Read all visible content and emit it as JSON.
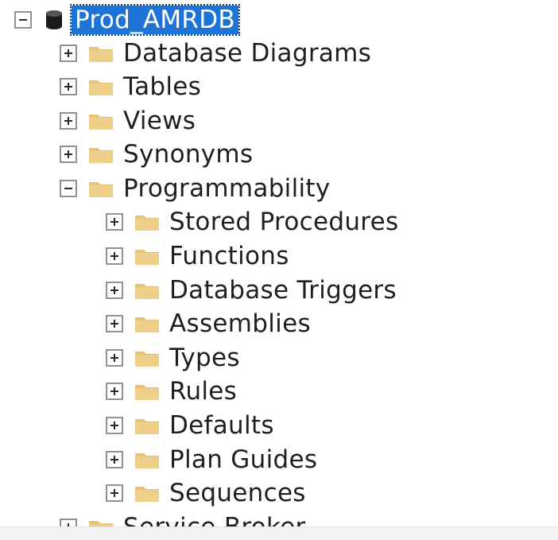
{
  "tree": {
    "root": {
      "label": "Prod_AMRDB",
      "expanded": true,
      "selected": true,
      "icon": "database-icon"
    },
    "children": [
      {
        "label": "Database Diagrams",
        "expanded": false,
        "icon": "folder-icon"
      },
      {
        "label": "Tables",
        "expanded": false,
        "icon": "folder-icon"
      },
      {
        "label": "Views",
        "expanded": false,
        "icon": "folder-icon"
      },
      {
        "label": "Synonyms",
        "expanded": false,
        "icon": "folder-icon"
      },
      {
        "label": "Programmability",
        "expanded": true,
        "icon": "folder-icon",
        "children": [
          {
            "label": "Stored Procedures",
            "expanded": false,
            "icon": "folder-icon"
          },
          {
            "label": "Functions",
            "expanded": false,
            "icon": "folder-icon"
          },
          {
            "label": "Database Triggers",
            "expanded": false,
            "icon": "folder-icon"
          },
          {
            "label": "Assemblies",
            "expanded": false,
            "icon": "folder-icon"
          },
          {
            "label": "Types",
            "expanded": false,
            "icon": "folder-icon"
          },
          {
            "label": "Rules",
            "expanded": false,
            "icon": "folder-icon"
          },
          {
            "label": "Defaults",
            "expanded": false,
            "icon": "folder-icon"
          },
          {
            "label": "Plan Guides",
            "expanded": false,
            "icon": "folder-icon"
          },
          {
            "label": "Sequences",
            "expanded": false,
            "icon": "folder-icon"
          }
        ]
      },
      {
        "label": "Service Broker",
        "expanded": false,
        "icon": "folder-icon"
      }
    ]
  },
  "colors": {
    "selection": "#1e73d6",
    "folder": "#e8c27a",
    "text": "#1f1f1f",
    "toggle_border": "#919191"
  }
}
